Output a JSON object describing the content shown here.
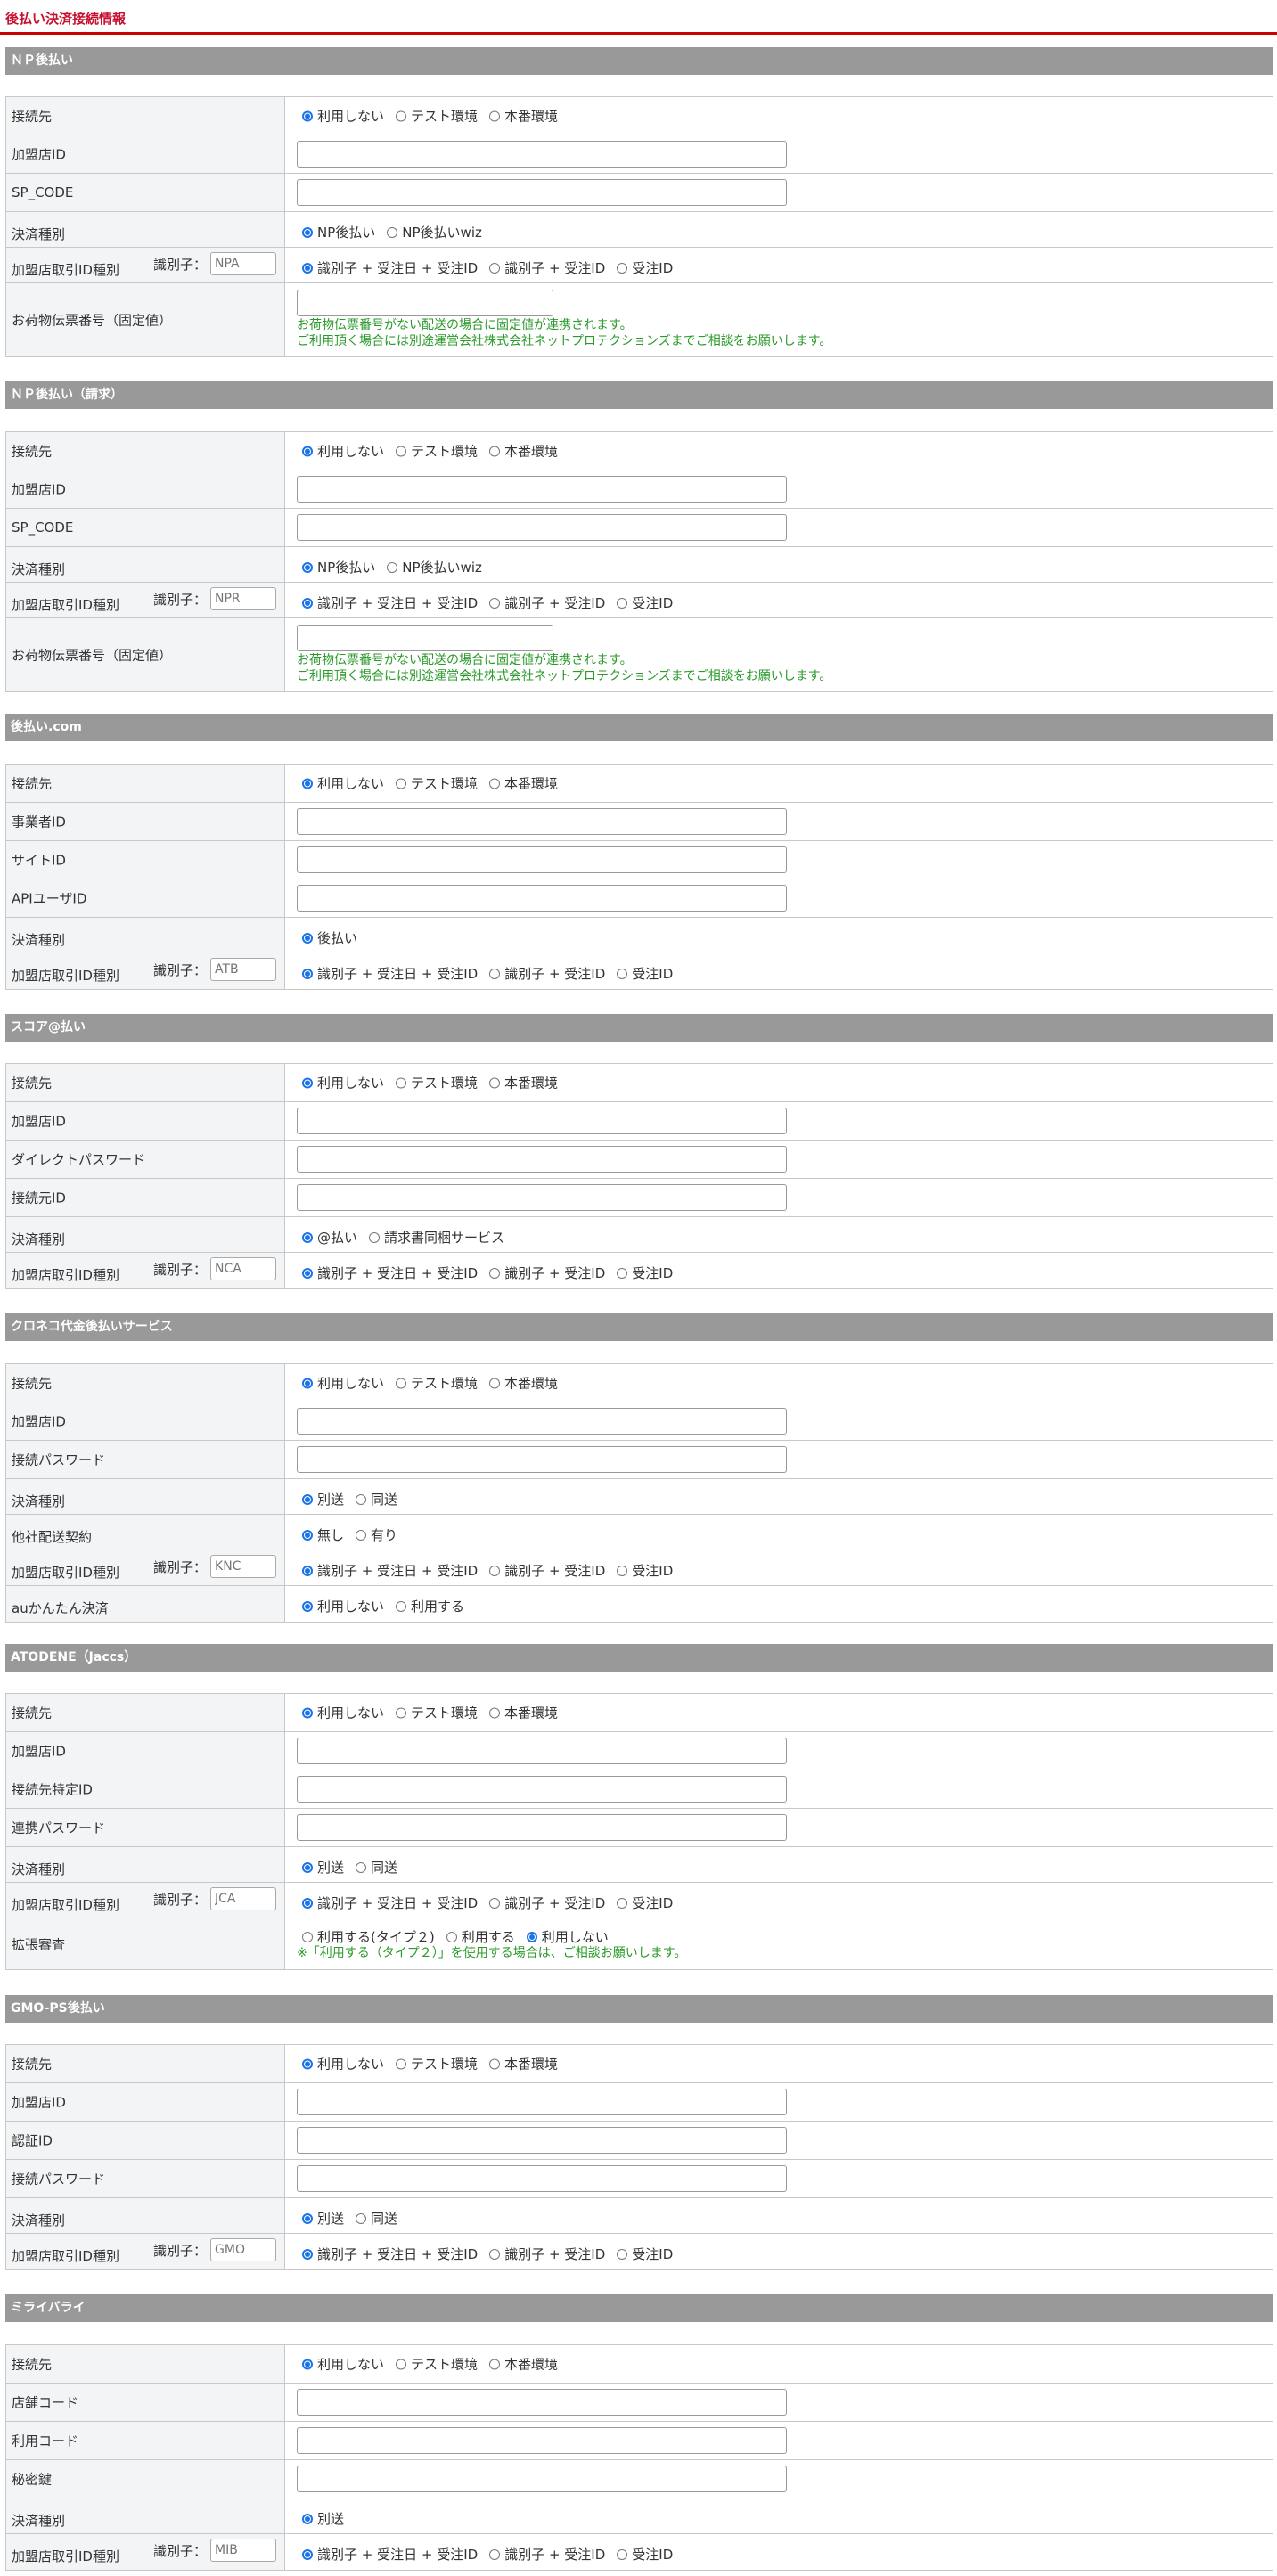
{
  "page": {
    "title": "後払い決済接続情報"
  },
  "labels": {
    "conn": "接続先",
    "merchant_id": "加盟店ID",
    "sp_code": "SP_CODE",
    "payment_type": "決済種別",
    "txn_id_type": "加盟店取引ID種別",
    "ident_prefix": "識別子：",
    "tracking_no": "お荷物伝票番号（固定値）",
    "business_id": "事業者ID",
    "site_id": "サイトID",
    "api_user_id": "APIユーザID",
    "direct_password": "ダイレクトパスワード",
    "conn_source_id": "接続元ID",
    "conn_password": "接続パスワード",
    "other_delivery": "他社配送契約",
    "au_easy": "auかんたん決済",
    "conn_specific_id": "接続先特定ID",
    "link_password": "連携パスワード",
    "ext_review": "拡張審査",
    "auth_id": "認証ID",
    "shop_code": "店舗コード",
    "use_code": "利用コード",
    "secret_key": "秘密鍵"
  },
  "options": {
    "conn": [
      "利用しない",
      "テスト環境",
      "本番環境"
    ],
    "np_type": [
      "NP後払い",
      "NP後払いwiz"
    ],
    "id_type": [
      "識別子 + 受注日 + 受注ID",
      "識別子 + 受注ID",
      "受注ID"
    ],
    "atobarai_type": [
      "後払い"
    ],
    "score_type": [
      "@払い",
      "請求書同梱サービス"
    ],
    "shipping": [
      "別送",
      "同送"
    ],
    "other_delivery": [
      "無し",
      "有り"
    ],
    "au_easy": [
      "利用しない",
      "利用する"
    ],
    "ext_review": [
      "利用する(タイプ２)",
      "利用する",
      "利用しない"
    ],
    "separate_only": [
      "別送"
    ]
  },
  "notes": {
    "tracking_line1": "お荷物伝票番号がない配送の場合に固定値が連携されます。",
    "tracking_line2": "ご利用頂く場合には別途運営会社株式会社ネットプロテクションズまでご相談をお願いします。",
    "ext_review": "※「利用する（タイプ２）」を使用する場合は、ご相談お願いします。"
  },
  "sections": {
    "np": {
      "title": "ＮＰ後払い",
      "ident_placeholder": "NPA"
    },
    "npr": {
      "title": "ＮＰ後払い（請求）",
      "ident_placeholder": "NPR"
    },
    "atobarai": {
      "title": "後払い.com",
      "ident_placeholder": "ATB"
    },
    "score": {
      "title": "スコア@払い",
      "ident_placeholder": "NCA"
    },
    "kuroneko": {
      "title": "クロネコ代金後払いサービス",
      "ident_placeholder": "KNC"
    },
    "atodene": {
      "title": "ATODENE（Jaccs）",
      "ident_placeholder": "JCA"
    },
    "gmo": {
      "title": "GMO-PS後払い",
      "ident_placeholder": "GMO"
    },
    "mirai": {
      "title": "ミライバライ",
      "ident_placeholder": "MIB"
    }
  },
  "colors": {
    "title_red": "#c8102e",
    "section_gray": "#999999",
    "label_bg": "#f2f4f6",
    "note_green": "#2a9a2a",
    "radio_blue": "#1a73e8"
  }
}
